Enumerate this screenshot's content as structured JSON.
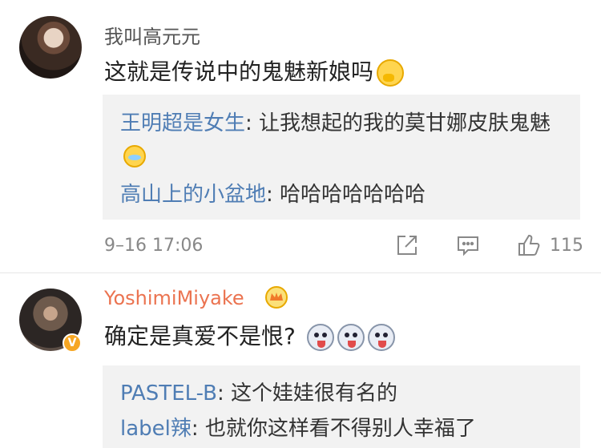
{
  "comments": [
    {
      "username": "我叫高元元",
      "text": "这就是传说中的鬼魅新娘吗",
      "emoji": "thinking-emoji",
      "replies": [
        {
          "user": "王明超是女生",
          "text": "让我想起的我的莫甘娜皮肤鬼魅",
          "emoji": "laugh-cry-emoji"
        },
        {
          "user": "高山上的小盆地",
          "text": "哈哈哈哈哈哈哈"
        }
      ],
      "timestamp": "9–16 17:06",
      "likes": "115"
    },
    {
      "username": "YoshimiMiyake",
      "badge": "V",
      "text": "确定是真爱不是恨?",
      "emojis": [
        "husky-emoji",
        "husky-emoji",
        "husky-emoji"
      ],
      "replies": [
        {
          "user": "PASTEL-B",
          "text": "这个娃娃很有名的"
        },
        {
          "user": "label辣",
          "text": "也就你这样看不得别人幸福了"
        }
      ]
    }
  ],
  "separator": ": ",
  "colors": {
    "username_orange": "#eb7350",
    "reply_name_blue": "#4f7db4",
    "reply_bg": "#f2f2f2",
    "meta_gray": "#888888"
  }
}
